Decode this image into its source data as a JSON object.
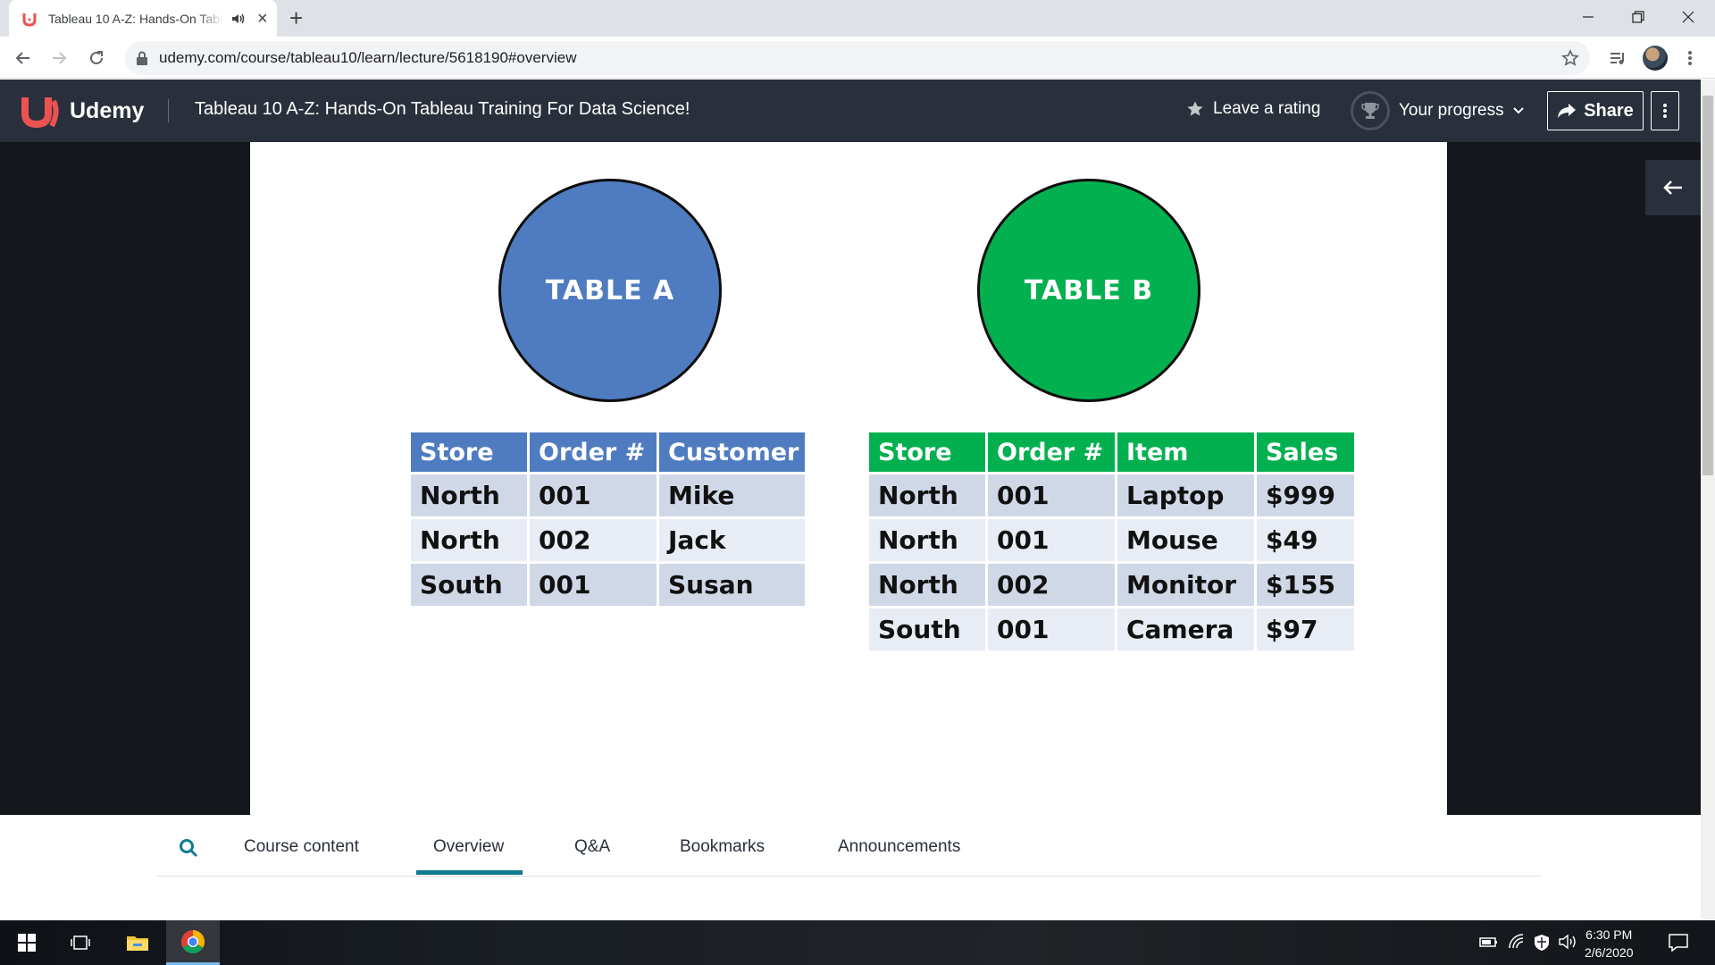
{
  "browser": {
    "tab_title": "Tableau 10 A-Z: Hands-On Tableau Training For Data Science!",
    "url": "udemy.com/course/tableau10/learn/lecture/5618190#overview"
  },
  "header": {
    "brand": "Udemy",
    "course_title": "Tableau 10 A-Z: Hands-On Tableau Training For Data Science!",
    "rating_label": "Leave a rating",
    "progress_label": "Your progress",
    "share_label": "Share"
  },
  "slide": {
    "circle_a": "TABLE A",
    "circle_b": "TABLE B",
    "table_a": {
      "headers": [
        "Store",
        "Order #",
        "Customer"
      ],
      "rows": [
        [
          "North",
          "001",
          "Mike"
        ],
        [
          "North",
          "002",
          "Jack"
        ],
        [
          "South",
          "001",
          "Susan"
        ]
      ]
    },
    "table_b": {
      "headers": [
        "Store",
        "Order #",
        "Item",
        "Sales"
      ],
      "rows": [
        [
          "North",
          "001",
          "Laptop",
          "$999"
        ],
        [
          "North",
          "001",
          "Mouse",
          "$49"
        ],
        [
          "North",
          "002",
          "Monitor",
          "$155"
        ],
        [
          "South",
          "001",
          "Camera",
          "$97"
        ]
      ]
    }
  },
  "course_nav": {
    "tabs": [
      "Course content",
      "Overview",
      "Q&A",
      "Bookmarks",
      "Announcements"
    ],
    "active_tab": "Overview"
  },
  "taskbar": {
    "time": "6:30 PM",
    "date": "2/6/2020"
  },
  "colors": {
    "udemy_header": "#29303b",
    "udemy_red": "#ec5252",
    "table_a_blue": "#4f7cc0",
    "table_b_green": "#03b050",
    "active_tab_underline": "#0f7c90"
  }
}
